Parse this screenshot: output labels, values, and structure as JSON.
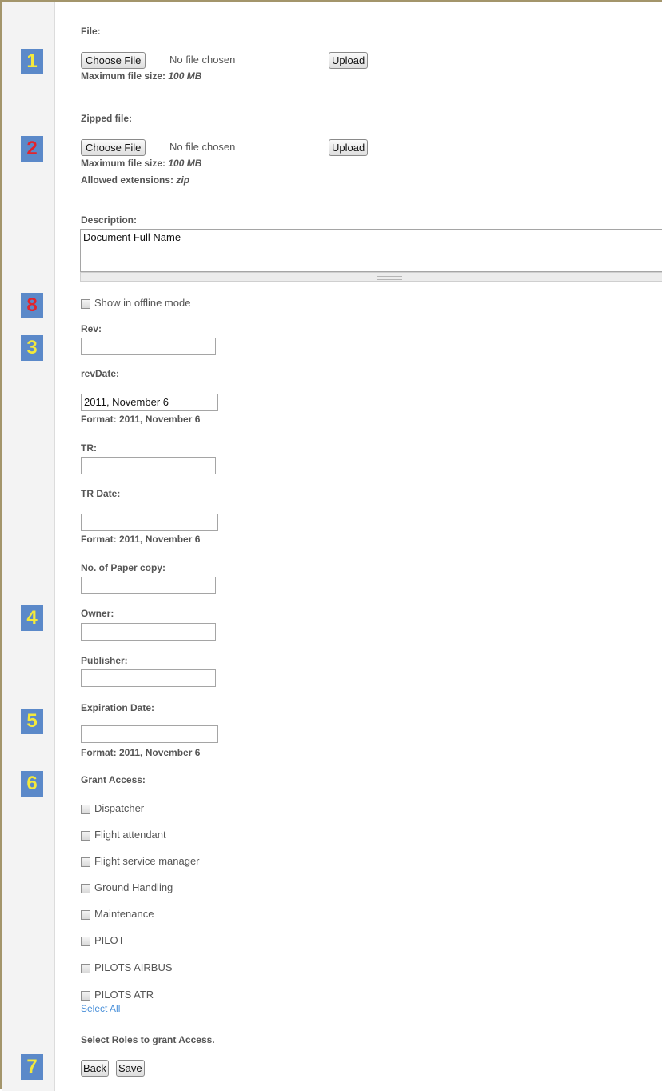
{
  "badges": [
    "1",
    "2",
    "8",
    "3",
    "4",
    "5",
    "6",
    "7"
  ],
  "file": {
    "label": "File:",
    "choose_label": "Choose File",
    "status": "No file chosen",
    "upload_label": "Upload",
    "max_size_prefix": "Maximum file size:",
    "max_size_value": "100 MB"
  },
  "zipped": {
    "label": "Zipped file:",
    "choose_label": "Choose File",
    "status": "No file chosen",
    "upload_label": "Upload",
    "max_size_prefix": "Maximum file size:",
    "max_size_value": "100 MB",
    "ext_prefix": "Allowed extensions:",
    "ext_value": "zip"
  },
  "description": {
    "label": "Description:",
    "value": "Document Full Name"
  },
  "offline": {
    "label": "Show in offline mode"
  },
  "rev": {
    "label": "Rev:",
    "value": ""
  },
  "rev_date": {
    "label": "revDate:",
    "value": "2011, November 6",
    "format": "Format: 2011, November 6"
  },
  "tr": {
    "label": "TR:",
    "value": ""
  },
  "tr_date": {
    "label": "TR Date:",
    "value": "",
    "format": "Format: 2011, November 6"
  },
  "paper_copy": {
    "label": "No. of Paper copy:",
    "value": ""
  },
  "owner": {
    "label": "Owner:",
    "value": ""
  },
  "publisher": {
    "label": "Publisher:",
    "value": ""
  },
  "expiration": {
    "label": "Expiration Date:",
    "value": "",
    "format": "Format: 2011, November 6"
  },
  "grant": {
    "label": "Grant Access:",
    "roles": [
      "Dispatcher",
      "Flight attendant",
      "Flight service manager",
      "Ground Handling",
      "Maintenance",
      "PILOT",
      "PILOTS AIRBUS",
      "PILOTS ATR"
    ],
    "select_all": "Select All",
    "hint": "Select Roles to grant Access."
  },
  "actions": {
    "back_label": "Back",
    "save_label": "Save"
  }
}
